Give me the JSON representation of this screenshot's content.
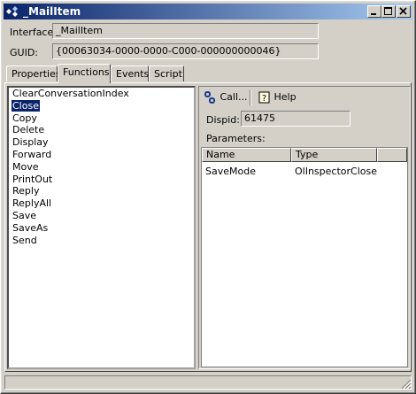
{
  "window": {
    "title": "_MailItem"
  },
  "header": {
    "interface_label": "Interface:",
    "interface_value": "_MailItem",
    "guid_label": "GUID:",
    "guid_value": "{00063034-0000-0000-C000-000000000046}"
  },
  "tabs": [
    "Properties",
    "Functions",
    "Events",
    "Script"
  ],
  "active_tab": "Functions",
  "functions": [
    "ClearConversationIndex",
    "Close",
    "Copy",
    "Delete",
    "Display",
    "Forward",
    "Move",
    "PrintOut",
    "Reply",
    "ReplyAll",
    "Save",
    "SaveAs",
    "Send"
  ],
  "selected_function": "Close",
  "toolbar": {
    "call_label": "Call...",
    "help_label": "Help"
  },
  "detail": {
    "dispid_label": "Dispid:",
    "dispid_value": "61475",
    "parameters_label": "Parameters:",
    "columns": [
      "Name",
      "Type"
    ],
    "rows": [
      {
        "name": "SaveMode",
        "type": "OlInspectorClose"
      }
    ]
  }
}
